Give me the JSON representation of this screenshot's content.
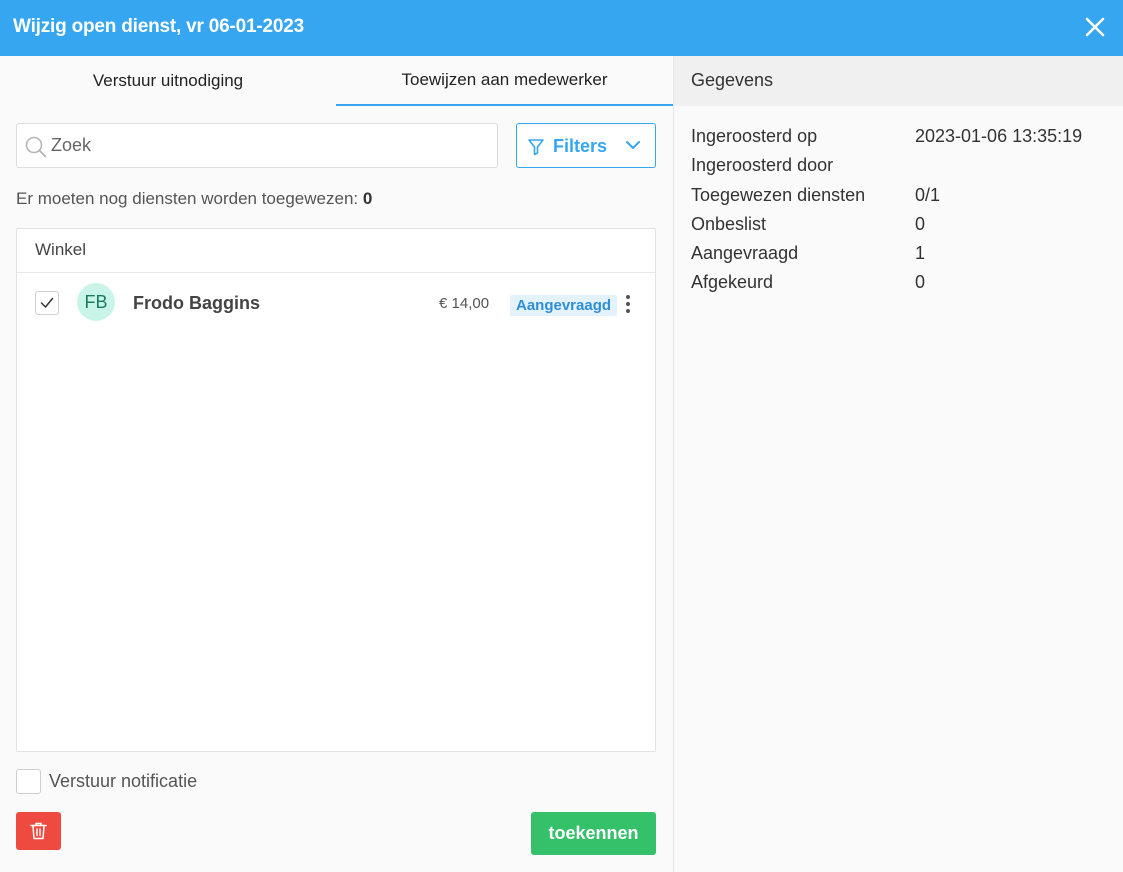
{
  "dialog": {
    "title": "Wijzig open dienst, vr 06-01-2023",
    "close_icon": "close-icon"
  },
  "tabs": [
    {
      "label": "Verstuur uitnodiging",
      "active": false
    },
    {
      "label": "Toewijzen aan medewerker",
      "active": true
    }
  ],
  "search": {
    "placeholder": "Zoek",
    "value": ""
  },
  "filters": {
    "label": "Filters"
  },
  "remaining": {
    "label": "Er moeten nog diensten worden toegewezen:",
    "count": "0"
  },
  "list": {
    "group": "Winkel",
    "rows": [
      {
        "initials": "FB",
        "name": "Frodo Baggins",
        "price": "€ 14,00",
        "status": "Aangevraagd",
        "checked": true
      }
    ]
  },
  "notify": {
    "label": "Verstuur notificatie",
    "checked": false
  },
  "actions": {
    "assign_label": "toekennen",
    "delete_icon": "trash-icon"
  },
  "details": {
    "title": "Gegevens",
    "rows": [
      {
        "key": "Ingeroosterd op",
        "value": "2023-01-06 13:35:19"
      },
      {
        "key": "Ingeroosterd door",
        "value": ""
      },
      {
        "key": "Toegewezen diensten",
        "value": "0/1"
      },
      {
        "key": "Onbeslist",
        "value": "0"
      },
      {
        "key": "Aangevraagd",
        "value": "1"
      },
      {
        "key": "Afgekeurd",
        "value": "0"
      }
    ]
  },
  "colors": {
    "header": "#35a6ef",
    "assign": "#35c06a",
    "delete": "#ef4a3f",
    "badge_bg": "#e4f2fc",
    "avatar_bg": "#c9f5e8"
  }
}
